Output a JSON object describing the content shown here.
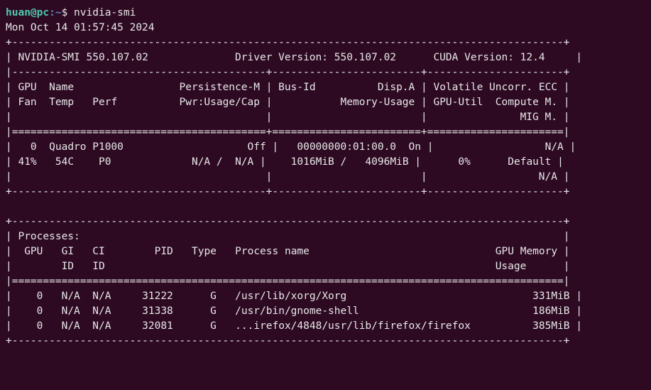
{
  "prompt": {
    "user_host": "huan@pc",
    "path_sep": ":",
    "path": "~",
    "symbol": "$",
    "command": "nvidia-smi"
  },
  "timestamp": "Mon Oct 14 01:57:45 2024",
  "header": {
    "smi_label": "NVIDIA-SMI",
    "smi_version": "550.107.02",
    "driver_label": "Driver Version:",
    "driver_version": "550.107.02",
    "cuda_label": "CUDA Version:",
    "cuda_version": "12.4"
  },
  "gpu_block": {
    "cols": {
      "gpu": "GPU",
      "name": "Name",
      "persistence": "Persistence-M",
      "busid": "Bus-Id",
      "dispa": "Disp.A",
      "volatile": "Volatile",
      "uncorr": "Uncorr. ECC",
      "fan": "Fan",
      "temp": "Temp",
      "perf": "Perf",
      "pwr": "Pwr:Usage/Cap",
      "memusage": "Memory-Usage",
      "gpuutil": "GPU-Util",
      "compute": "Compute M.",
      "mig": "MIG M."
    },
    "row": {
      "gpu": "0",
      "name": "Quadro P1000",
      "persistence": "Off",
      "busid": "00000000:01:00.0",
      "dispa": "On",
      "ecc": "N/A",
      "fan": "41%",
      "temp": "54C",
      "perf": "P0",
      "pwr": "N/A /  N/A",
      "mem_used": "1016MiB",
      "mem_total": "4096MiB",
      "gpuutil": "0%",
      "compute": "Default",
      "mig": "N/A"
    }
  },
  "proc_block": {
    "title": "Processes:",
    "cols": {
      "gpu": "GPU",
      "gi": "GI",
      "ci": "CI",
      "pid": "PID",
      "type": "Type",
      "pname": "Process name",
      "gmem": "GPU Memory",
      "id": "ID",
      "usage": "Usage"
    },
    "rows": [
      {
        "gpu": "0",
        "gi": "N/A",
        "ci": "N/A",
        "pid": "31222",
        "type": "G",
        "pname": "/usr/lib/xorg/Xorg",
        "mem": "331MiB"
      },
      {
        "gpu": "0",
        "gi": "N/A",
        "ci": "N/A",
        "pid": "31338",
        "type": "G",
        "pname": "/usr/bin/gnome-shell",
        "mem": "186MiB"
      },
      {
        "gpu": "0",
        "gi": "N/A",
        "ci": "N/A",
        "pid": "32081",
        "type": "G",
        "pname": "...irefox/4848/usr/lib/firefox/firefox",
        "mem": "385MiB"
      }
    ]
  },
  "chart_data": {
    "type": "table",
    "title": "nvidia-smi",
    "gpus": [
      {
        "index": 0,
        "name": "Quadro P1000",
        "persistence_mode": "Off",
        "bus_id": "00000000:01:00.0",
        "display_active": "On",
        "ecc": "N/A",
        "fan_pct": 41,
        "temp_c": 54,
        "perf_state": "P0",
        "power_usage": "N/A",
        "power_cap": "N/A",
        "mem_used_mib": 1016,
        "mem_total_mib": 4096,
        "gpu_util_pct": 0,
        "compute_mode": "Default",
        "mig_mode": "N/A"
      }
    ],
    "processes": [
      {
        "gpu": 0,
        "gi": "N/A",
        "ci": "N/A",
        "pid": 31222,
        "type": "G",
        "name": "/usr/lib/xorg/Xorg",
        "mem_mib": 331
      },
      {
        "gpu": 0,
        "gi": "N/A",
        "ci": "N/A",
        "pid": 31338,
        "type": "G",
        "name": "/usr/bin/gnome-shell",
        "mem_mib": 186
      },
      {
        "gpu": 0,
        "gi": "N/A",
        "ci": "N/A",
        "pid": 32081,
        "type": "G",
        "name": "...irefox/4848/usr/lib/firefox/firefox",
        "mem_mib": 385
      }
    ]
  }
}
